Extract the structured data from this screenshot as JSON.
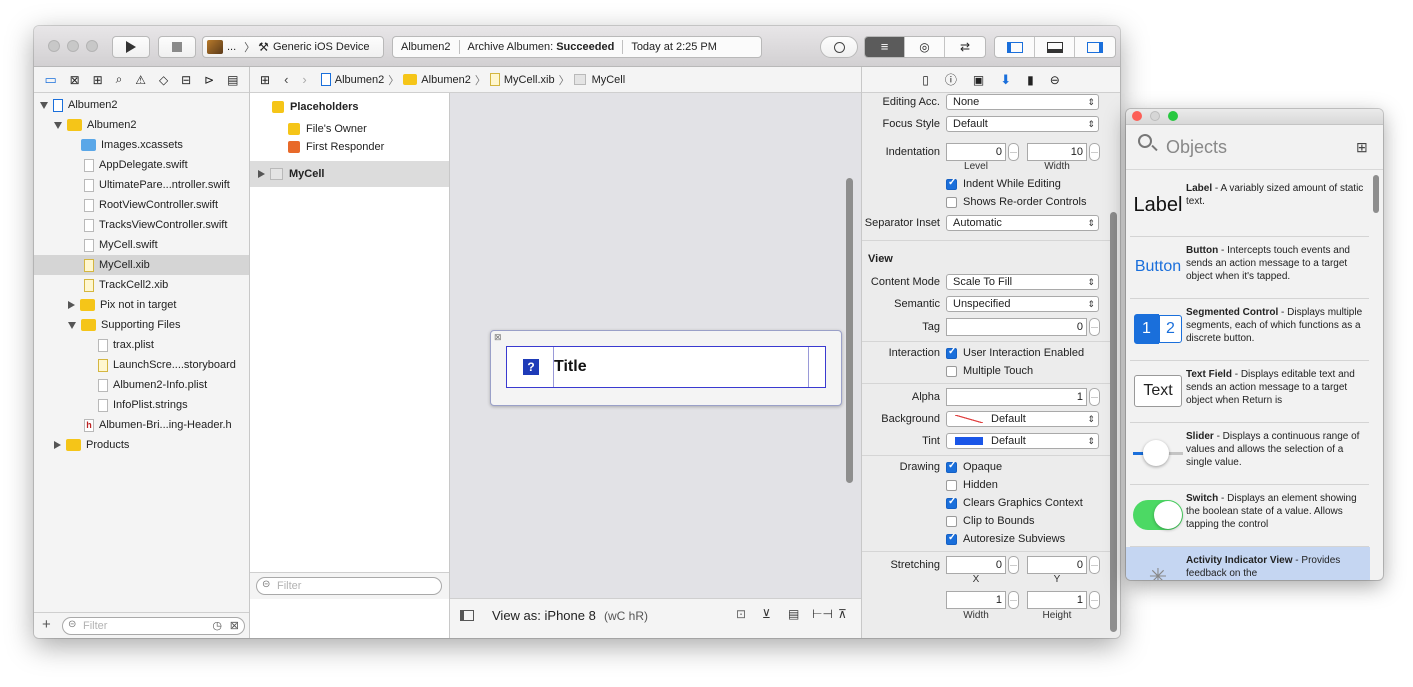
{
  "toolbar": {
    "scheme_label": "...",
    "device_label": "Generic iOS Device",
    "status_project": "Albumen2",
    "status_action": "Archive Albumen:",
    "status_result": "Succeeded",
    "status_time": "Today at 2:25 PM"
  },
  "navigator": {
    "items": [
      {
        "label": "Albumen2"
      },
      {
        "label": "Albumen2"
      },
      {
        "label": "Images.xcassets"
      },
      {
        "label": "AppDelegate.swift"
      },
      {
        "label": "UltimatePare...ntroller.swift"
      },
      {
        "label": "RootViewController.swift"
      },
      {
        "label": "TracksViewController.swift"
      },
      {
        "label": "MyCell.swift"
      },
      {
        "label": "MyCell.xib"
      },
      {
        "label": "TrackCell2.xib"
      },
      {
        "label": "Pix not in target"
      },
      {
        "label": "Supporting Files"
      },
      {
        "label": "trax.plist"
      },
      {
        "label": "LaunchScre....storyboard"
      },
      {
        "label": "Albumen2-Info.plist"
      },
      {
        "label": "InfoPlist.strings"
      },
      {
        "label": "Albumen-Bri...ing-Header.h"
      },
      {
        "label": "Products"
      }
    ],
    "filter_placeholder": "Filter"
  },
  "jumpbar": {
    "crumbs": [
      "Albumen2",
      "Albumen2",
      "MyCell.xib",
      "MyCell"
    ]
  },
  "outline": {
    "placeholders": "Placeholders",
    "files_owner": "File's Owner",
    "first_responder": "First Responder",
    "mycell": "MyCell",
    "filter_placeholder": "Filter"
  },
  "canvas": {
    "cell_title": "Title",
    "cell_icon": "?",
    "view_as": "View as: iPhone 8",
    "size_class": "(wC hR)"
  },
  "inspector": {
    "editing_acc_label": "Editing Acc.",
    "editing_acc_value": "None",
    "focus_style_label": "Focus Style",
    "focus_style_value": "Default",
    "indentation_label": "Indentation",
    "indentation_level": "0",
    "indentation_width": "10",
    "level_sub": "Level",
    "width_sub": "Width",
    "indent_while_editing": "Indent While Editing",
    "shows_reorder": "Shows Re-order Controls",
    "separator_inset_label": "Separator Inset",
    "separator_inset_value": "Automatic",
    "view_header": "View",
    "content_mode_label": "Content Mode",
    "content_mode_value": "Scale To Fill",
    "semantic_label": "Semantic",
    "semantic_value": "Unspecified",
    "tag_label": "Tag",
    "tag_value": "0",
    "interaction_label": "Interaction",
    "user_interaction": "User Interaction Enabled",
    "multiple_touch": "Multiple Touch",
    "alpha_label": "Alpha",
    "alpha_value": "1",
    "background_label": "Background",
    "background_value": "Default",
    "tint_label": "Tint",
    "tint_value": "Default",
    "tint_color": "#1a56e8",
    "drawing_label": "Drawing",
    "opaque": "Opaque",
    "hidden": "Hidden",
    "clears_graphics": "Clears Graphics Context",
    "clip_to_bounds": "Clip to Bounds",
    "autoresize": "Autoresize Subviews",
    "stretching_label": "Stretching",
    "stretch_x": "0",
    "stretch_y": "0",
    "stretch_w": "1",
    "stretch_h": "1",
    "x_sub": "X",
    "y_sub": "Y",
    "w_sub": "Width",
    "h_sub": "Height"
  },
  "library": {
    "title": "Objects",
    "items": [
      {
        "icon_text": "Label",
        "name": "Label",
        "desc": " - A variably sized amount of static text."
      },
      {
        "icon_text": "Button",
        "name": "Button",
        "desc": " - Intercepts touch events and sends an action message to a target object when it's tapped."
      },
      {
        "icon_text": "",
        "name": "Segmented Control",
        "desc": " - Displays multiple segments, each of which functions as a discrete button."
      },
      {
        "icon_text": "Text",
        "name": "Text Field",
        "desc": " - Displays editable text and sends an action message to a target object when Return is"
      },
      {
        "icon_text": "",
        "name": "Slider",
        "desc": " - Displays a continuous range of values and allows the selection of a single value."
      },
      {
        "icon_text": "",
        "name": "Switch",
        "desc": " - Displays an element showing the boolean state of a value. Allows tapping the control"
      },
      {
        "icon_text": "",
        "name": "Activity Indicator View",
        "desc": " - Provides feedback on the"
      }
    ],
    "segment_1": "1",
    "segment_2": "2"
  },
  "colors": {
    "accent": "#1a6fdb",
    "switch_on": "#4cd964",
    "selection": "#d5d5d5",
    "library_selection": "#c5d6f2"
  }
}
